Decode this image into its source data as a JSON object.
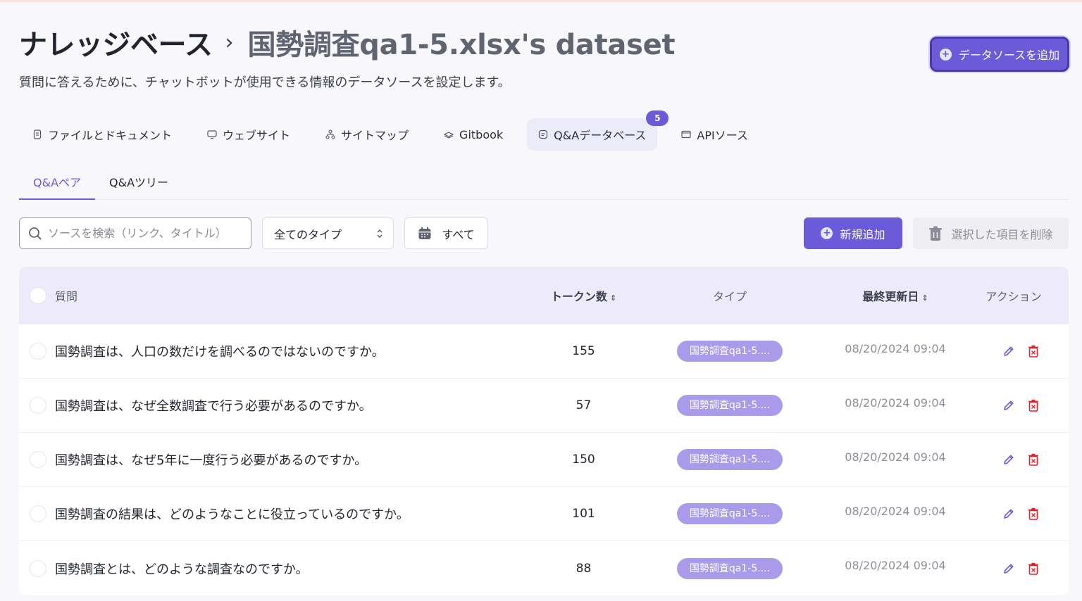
{
  "header": {
    "title": "ナレッジベース",
    "separator": "›",
    "dataset": "国勢調査qa1-5.xlsx's dataset",
    "subtitle": "質問に答えるために、チャットボットが使用できる情報のデータソースを設定します。",
    "add_source_label": "データソースを追加"
  },
  "source_tabs": [
    {
      "label": "ファイルとドキュメント",
      "icon": "file-icon"
    },
    {
      "label": "ウェブサイト",
      "icon": "monitor-icon"
    },
    {
      "label": "サイトマップ",
      "icon": "sitemap-icon"
    },
    {
      "label": "Gitbook",
      "icon": "gitbook-icon"
    },
    {
      "label": "Q&Aデータベース",
      "icon": "qa-icon",
      "badge": "5",
      "active": true
    },
    {
      "label": "APIソース",
      "icon": "api-icon"
    }
  ],
  "sub_tabs": [
    {
      "label": "Q&Aペア",
      "active": true
    },
    {
      "label": "Q&Aツリー"
    }
  ],
  "toolbar": {
    "search_placeholder": "ソースを検索（リンク、タイトル）",
    "type_filter": "全てのタイプ",
    "date_filter": "すべて",
    "new_label": "新規追加",
    "delete_selected_label": "選択した項目を削除"
  },
  "table": {
    "columns": {
      "question": "質問",
      "tokens": "トークン数",
      "type": "タイプ",
      "updated": "最終更新日",
      "actions": "アクション"
    },
    "rows": [
      {
        "question": "国勢調査は、人口の数だけを調べるのではないのですか。",
        "tokens": "155",
        "type": "国勢調査qa1-5....",
        "updated": "08/20/2024 09:04"
      },
      {
        "question": "国勢調査は、なぜ全数調査で行う必要があるのですか。",
        "tokens": "57",
        "type": "国勢調査qa1-5....",
        "updated": "08/20/2024 09:04"
      },
      {
        "question": "国勢調査は、なぜ5年に一度行う必要があるのですか。",
        "tokens": "150",
        "type": "国勢調査qa1-5....",
        "updated": "08/20/2024 09:04"
      },
      {
        "question": "国勢調査の結果は、どのようなことに役立っているのですか。",
        "tokens": "101",
        "type": "国勢調査qa1-5....",
        "updated": "08/20/2024 09:04"
      },
      {
        "question": "国勢調査とは、どのような調査なのですか。",
        "tokens": "88",
        "type": "国勢調査qa1-5....",
        "updated": "08/20/2024 09:04"
      }
    ]
  },
  "colors": {
    "accent": "#6b5bd8",
    "pill": "#a99bea",
    "delete_icon": "#e0202a",
    "edit_icon": "#6b5bd8"
  }
}
